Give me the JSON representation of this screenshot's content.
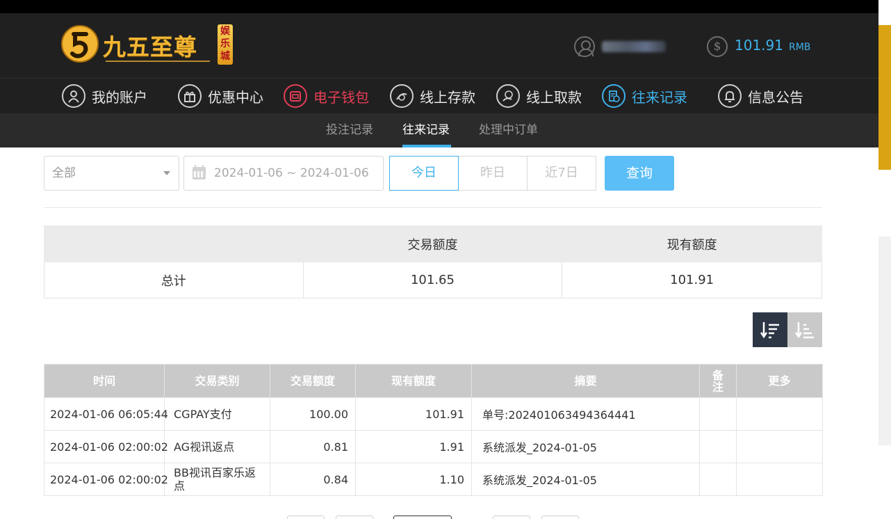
{
  "header": {
    "logo_text": "九五至尊",
    "logo_vertical": "娱乐城",
    "balance_symbol": "$",
    "balance_value": "101.91",
    "balance_unit": "RMB"
  },
  "main_nav": [
    {
      "label": "我的账户",
      "icon": "user-icon"
    },
    {
      "label": "优惠中心",
      "icon": "gift-icon"
    },
    {
      "label": "电子钱包",
      "icon": "wallet-icon"
    },
    {
      "label": "线上存款",
      "icon": "deposit-icon"
    },
    {
      "label": "线上取款",
      "icon": "withdraw-icon"
    },
    {
      "label": "往来记录",
      "icon": "records-icon"
    },
    {
      "label": "信息公告",
      "icon": "bell-icon"
    }
  ],
  "sub_nav": [
    {
      "label": "投注记录"
    },
    {
      "label": "往来记录"
    },
    {
      "label": "处理中订单"
    }
  ],
  "filters": {
    "type_selected": "全部",
    "date_range": "2024-01-06 ~ 2024-01-06",
    "quick": [
      "今日",
      "昨日",
      "近7日"
    ],
    "search_label": "查询"
  },
  "summary": {
    "headers": [
      "交易额度",
      "现有额度"
    ],
    "row_label": "总计",
    "trade_amount": "101.65",
    "current_amount": "101.91"
  },
  "records": {
    "headers": [
      "时间",
      "交易类别",
      "交易额度",
      "现有额度",
      "摘要",
      "备注",
      "更多"
    ],
    "rows": [
      {
        "time": "2024-01-06 06:05:44",
        "type": "CGPAY支付",
        "amount": "100.00",
        "balance": "101.91",
        "summary": "单号:202401063494364441"
      },
      {
        "time": "2024-01-06 02:00:02",
        "type": "AG视讯返点",
        "amount": "0.81",
        "balance": "1.91",
        "summary": "系统派发_2024-01-05"
      },
      {
        "time": "2024-01-06 02:00:02",
        "type": "BB视讯百家乐返点",
        "amount": "0.84",
        "balance": "1.10",
        "summary": "系统派发_2024-01-05"
      }
    ]
  },
  "colors": {
    "accent": "#3fb2ec",
    "wallet": "#e53e55",
    "header_bg": "#202020",
    "search_button": "#5bbef6",
    "table_header": "#c9c9c9",
    "sort_active": "#2d3645"
  }
}
